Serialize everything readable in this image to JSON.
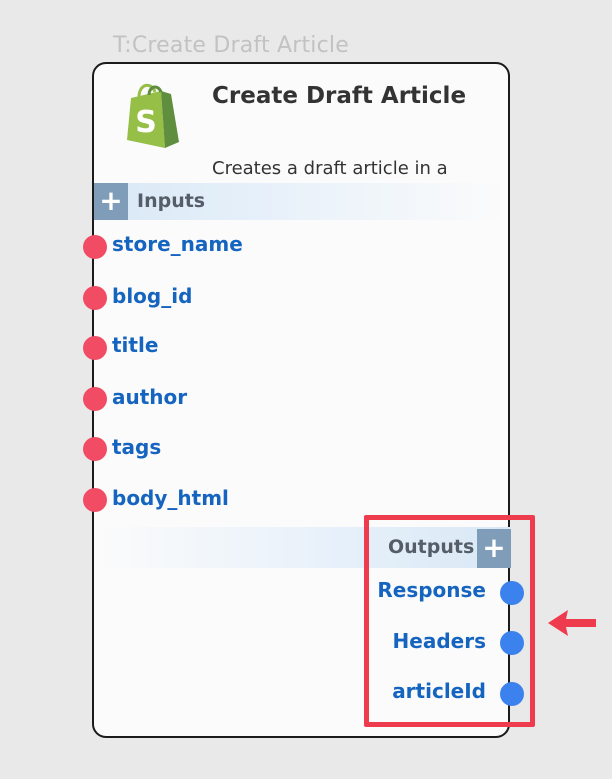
{
  "node": {
    "tag": "T:Create Draft Article",
    "title": "Create Draft Article",
    "description": "Creates a draft article in a",
    "logo_icon": "shopify-bag-icon"
  },
  "inputs": {
    "label": "Inputs",
    "add_symbol": "+",
    "ports": [
      "store_name",
      "blog_id",
      "title",
      "author",
      "tags",
      "body_html"
    ]
  },
  "outputs": {
    "label": "Outputs",
    "add_symbol": "+",
    "ports": [
      "Response",
      "Headers",
      "articleId"
    ]
  },
  "colors": {
    "input_port": "#f24c64",
    "output_port": "#3b82ef",
    "port_label": "#1565c0",
    "highlight": "#ef3b4e",
    "header_button": "#7f9cb8"
  }
}
